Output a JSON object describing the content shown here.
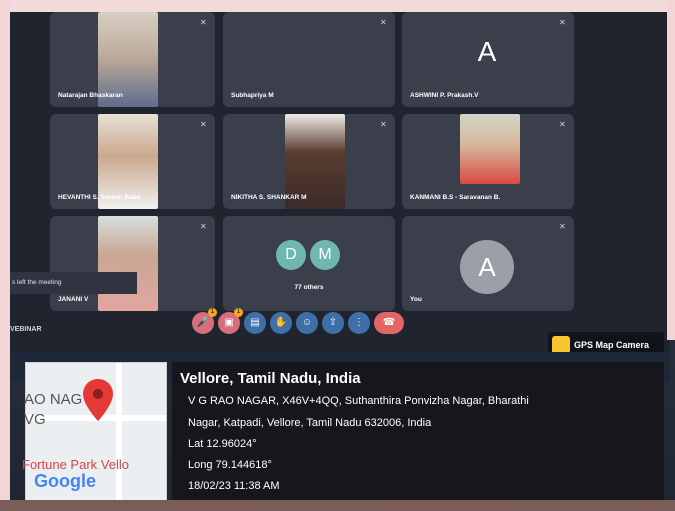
{
  "participants": [
    {
      "name": "Natarajan Bhaskaran",
      "type": "video"
    },
    {
      "name": "Subhapriya M",
      "type": "empty"
    },
    {
      "name": "ASHWINI P. Prakash.V",
      "type": "avatar",
      "initial": "A"
    },
    {
      "name": "HEVANTHI S. Suresh Babu",
      "type": "video"
    },
    {
      "name": "NIKITHA S. SHANKAR M",
      "type": "video"
    },
    {
      "name": "KANMANI B.S - Saravanan B.",
      "type": "video"
    },
    {
      "name": "JANANI V",
      "type": "video"
    },
    {
      "name": "77 others",
      "type": "group",
      "initials": [
        "D",
        "M"
      ]
    },
    {
      "name": "You",
      "type": "avatar",
      "initial": "A"
    }
  ],
  "toast": "s left the meeting",
  "webinar_label": "VEBINAR",
  "controls": {
    "badges": [
      "1",
      "1"
    ]
  },
  "gps_label": "GPS Map Camera",
  "location": {
    "city": "Vellore, Tamil Nadu, India",
    "address_line1": "V G RAO NAGAR, X46V+4QQ, Suthanthira Ponvizha Nagar, Bharathi",
    "address_line2": "Nagar, Katpadi, Vellore, Tamil Nadu 632006, India",
    "lat": "Lat 12.96024°",
    "long": "Long 79.144618°",
    "datetime": "18/02/23 11:38 AM"
  },
  "map": {
    "label1": "AO NAG",
    "label2": "VG",
    "label3": "Fortune Park Vello",
    "google": "Google"
  },
  "colors": {
    "tile": "#3a3f4b",
    "avatar_grey": "#9c9fa8",
    "avatar_teal": "#6fb7b0",
    "leave": "#e46565",
    "pin": "#e53935"
  }
}
